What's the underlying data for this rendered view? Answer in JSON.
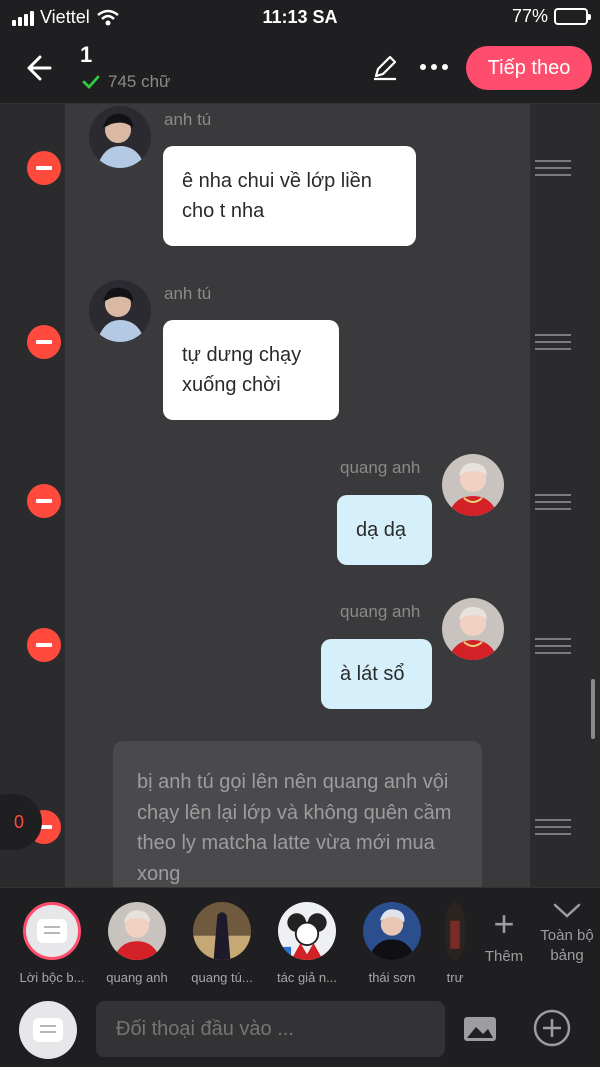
{
  "status": {
    "carrier": "Viettel",
    "time": "11:13 SA",
    "battery": "77%",
    "battery_level": 0.77
  },
  "header": {
    "chapter": "1",
    "word_count": "745 chữ",
    "next_label": "Tiếp theo"
  },
  "messages": [
    {
      "side": "left",
      "name": "anh tú",
      "lines": "ê nha chui về lớp liền cho t nha"
    },
    {
      "side": "left",
      "name": "anh tú",
      "lines": "tự dưng chạy xuống chời"
    },
    {
      "side": "right",
      "name": "quang anh",
      "lines": "dạ dạ"
    },
    {
      "side": "right",
      "name": "quang anh",
      "lines": "à lát sổ"
    }
  ],
  "narration": "bị anh tú gọi lên nên quang anh vội chạy lên lại lớp và không quên cầm theo ly matcha latte vừa mới mua xong",
  "counter": "0",
  "characters": [
    {
      "label": "Lời bộc b...",
      "icon": "narration-icon"
    },
    {
      "label": "quang anh"
    },
    {
      "label": "quang tú..."
    },
    {
      "label": "tác giả n..."
    },
    {
      "label": "thái sơn"
    },
    {
      "label": "trư"
    }
  ],
  "strip": {
    "add_label": "Thêm",
    "full_board_label": "Toàn bộ bảng"
  },
  "input": {
    "placeholder": "Đối thoại đầu vào ..."
  },
  "colors": {
    "accent": "#ff4d6d",
    "delete": "#ff4a3d",
    "right_bubble": "#d5f0fb"
  }
}
